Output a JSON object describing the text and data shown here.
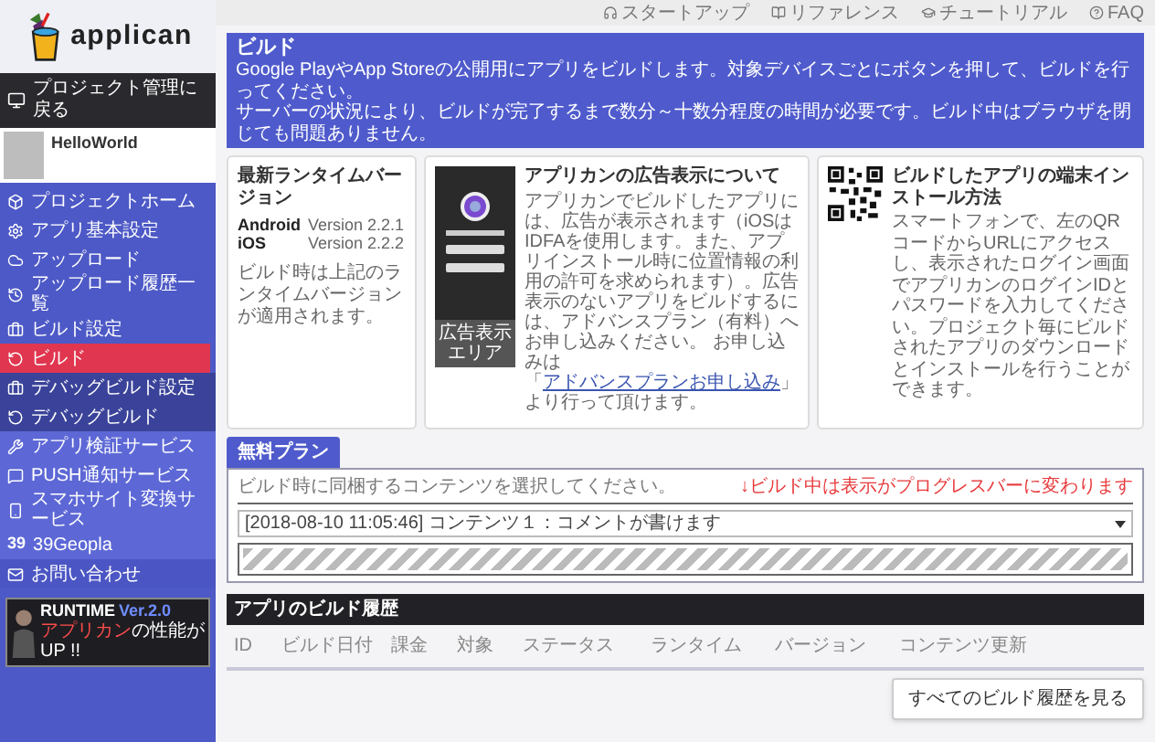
{
  "logo": {
    "text": "applican"
  },
  "back_button": {
    "label": "プロジェクト管理に戻る"
  },
  "project": {
    "name": "HelloWorld"
  },
  "sidebar": {
    "items": [
      {
        "label": "プロジェクトホーム",
        "kind": "main",
        "selected": false
      },
      {
        "label": "アプリ基本設定",
        "kind": "main",
        "selected": false
      },
      {
        "label": "アップロード",
        "kind": "main",
        "selected": false
      },
      {
        "label": "アップロード履歴一覧",
        "kind": "main",
        "selected": false
      },
      {
        "label": "ビルド設定",
        "kind": "main",
        "selected": false
      },
      {
        "label": "ビルド",
        "kind": "main",
        "selected": true
      },
      {
        "label": "デバッグビルド設定",
        "kind": "debug",
        "selected": false
      },
      {
        "label": "デバッグビルド",
        "kind": "debug",
        "selected": false
      },
      {
        "label": "アプリ検証サービス",
        "kind": "service",
        "selected": false
      },
      {
        "label": "PUSH通知サービス",
        "kind": "service",
        "selected": false
      },
      {
        "label": "スマホサイト変換サービス",
        "kind": "service",
        "selected": false
      },
      {
        "label": "39Geopla",
        "kind": "service",
        "selected": false,
        "icon_text": "39"
      },
      {
        "label": "お問い合わせ",
        "kind": "contact",
        "selected": false
      }
    ]
  },
  "promo_banner": {
    "title": "RUNTIME",
    "version": "Ver.2.0",
    "tagline_highlight": "アプリカン",
    "tagline": "の性能が UP !!"
  },
  "top_links": [
    "スタートアップ",
    "リファレンス",
    "チュートリアル",
    "FAQ"
  ],
  "header": {
    "title": "ビルド",
    "lines": [
      "Google PlayやApp Storeの公開用にアプリをビルドします。対象デバイスごとにボタンを押して、ビルドを行ってください。",
      "サーバーの状況により、ビルドが完了するまで数分～十数分程度の時間が必要です。ビルド中はブラウザを閉じても問題ありません。"
    ]
  },
  "runtime_card": {
    "title": "最新ランタイムバージョン",
    "versions": [
      {
        "platform": "Android",
        "version": "Version 2.2.1"
      },
      {
        "platform": "iOS",
        "version": "Version 2.2.2"
      }
    ],
    "note": "ビルド時は上記のランタイムバージョンが適用されます。"
  },
  "ad_card": {
    "ad_area_label": "広告表示エリア",
    "title": "アプリカンの広告表示について",
    "text_before": "アプリカンでビルドしたアプリには、広告が表示されます（iOSはIDFAを使用します。また、アプリインストール時に位置情報の利用の許可を求められます）。広告表示のないアプリをビルドするには、アドバンスプラン（有料）へお申し込みください。 お申し込みは「",
    "link": "アドバンスプランお申し込み",
    "text_after": "」より行って頂けます。"
  },
  "install_card": {
    "title": "ビルドしたアプリの端末インストール方法",
    "text": "スマートフォンで、左のQRコードからURLにアクセスし、表示されたログイン画面でアプリカンのログインIDとパスワードを入力してください。プロジェクト毎にビルドされたアプリのダウンロードとインストールを行うことができます。"
  },
  "plan": {
    "tab": "無料プラン",
    "hint": "ビルド時に同梱するコンテンツを選択してください。",
    "annotation": "↓ビルド中は表示がプログレスバーに変わります",
    "content_select": "[2018-08-10 11:05:46] コンテンツ１：コメントが書けます",
    "progress": {
      "level": 1
    }
  },
  "history": {
    "title": "アプリのビルド履歴",
    "columns": [
      "ID",
      "ビルド日付",
      "課金",
      "対象",
      "ステータス",
      "ランタイム",
      "バージョン",
      "コンテンツ更新"
    ],
    "button": "すべてのビルド履歴を見る"
  }
}
